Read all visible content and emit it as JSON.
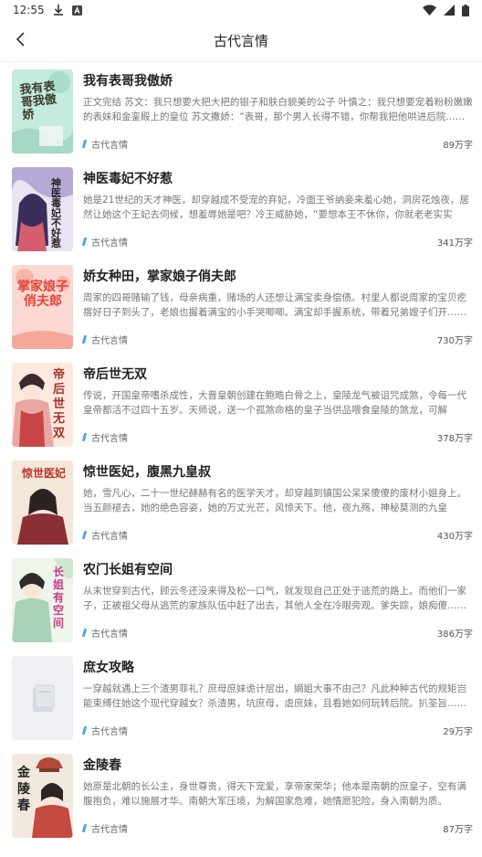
{
  "status": {
    "time": "12:55"
  },
  "nav": {
    "title": "古代言情"
  },
  "books": [
    {
      "title": "我有表哥我傲娇",
      "desc": "正文完结 苏文：我只想要大把大把的银子和肤白貌美的公子 叶慎之：我只想要宠着粉粉嫩嫩的表妹和金銮殿上的皇位 苏文撒娇：“表哥，那个男人长得不错，你帮我把他哄进后院……",
      "category": "古代言情",
      "words": "89万字",
      "cover_text": "我有表哥我傲娇",
      "cover_bg": "#bfe8dc"
    },
    {
      "title": "神医毒妃不好惹",
      "desc": "她是21世纪的天才神医，却穿越成不受宠的弃妃，冷面王爷纳妾来羞心她，洞房花烛夜，居然让她这个王妃去伺候，想羞辱她是吧？冷王威胁她，“要想本王不休你，你就老老实实的……",
      "category": "古代言情",
      "words": "341万字",
      "cover_text": "神医毒妃不好惹",
      "cover_bg": "#6b5aa8"
    },
    {
      "title": "娇女种田，掌家娘子俏夫郎",
      "desc": "周家的四哥赌输了钱，母亲病重，赌场的人还想让满宝卖身偿债。村里人都说周家的宝贝疙瘩好日子到头了，老娘也握着满宝的小手哭唧唧。满宝却手握系统，带着兄弟嫂子们开……",
      "category": "古代言情",
      "words": "730万字",
      "cover_text": "掌家娘子俏夫郎",
      "cover_bg": "#f6c7c0"
    },
    {
      "title": "帝后世无双",
      "desc": "传说，开国皇帝嗜杀成性，大晋皇朝创建在鲍晧白骨之上，皇陵龙气被诅咒成煞，令每一代皇帝都活不过四十五岁。天师说，送一个孤煞命格的皇子当供品喂食皇陵的煞龙，可解此……",
      "category": "古代言情",
      "words": "378万字",
      "cover_text": "帝后世无双",
      "cover_bg": "#fbe3d6"
    },
    {
      "title": "惊世医妃，腹黑九皇叔",
      "desc": "她，雪凡心，二十一世纪赫赫有名的医学天才，却穿越到镇国公呆呆傻傻的废材小姐身上。当五颜褪去，她的绝色容姿，她的万丈光芒，风惊天下。他，夜九殇，神秘莫测的九皇叔……",
      "category": "古代言情",
      "words": "430万字",
      "cover_text": "惊世医妃",
      "cover_bg": "#f2e2d6"
    },
    {
      "title": "农门长姐有空间",
      "desc": "从末世穿到古代，顾云冬还没来得及松一口气，就发现自己正处于逃荒的路上。而他们一家子，正被祖父母从逃荒的家族队伍中赶了出去，其他人全在冷眼旁观。爹失踪，娘痴傻……",
      "category": "古代言情",
      "words": "386万字",
      "cover_text": "长姐有空间",
      "cover_bg": "#e9f2e6"
    },
    {
      "title": "庶女攻略",
      "desc": "一穿越就遇上三个渣男菲礼？庶母庶妹诡计层出，嫡姐大事不由己？凡此种种古代的规矩岂能束缚住她这个现代穿越女？杀渣男，坑庶母，虐庶妹，且看她如何玩转后院。扒筌旨……",
      "category": "古代言情",
      "words": "29万字",
      "cover_text": "",
      "cover_bg": "#eef0f3"
    },
    {
      "title": "金陵春",
      "desc": "她原是北朝的长公主，身世尊贵，得天下宠爱，享帝家荣华；他本是南朝的庶皇子，空有满腹抱负，难以施展才华。南朝大军压境，为解国家危难，她情愿犯险，身入南朝为质。一……",
      "category": "古代言情",
      "words": "87万字",
      "cover_text": "金陵春",
      "cover_bg": "#efe6da"
    }
  ]
}
